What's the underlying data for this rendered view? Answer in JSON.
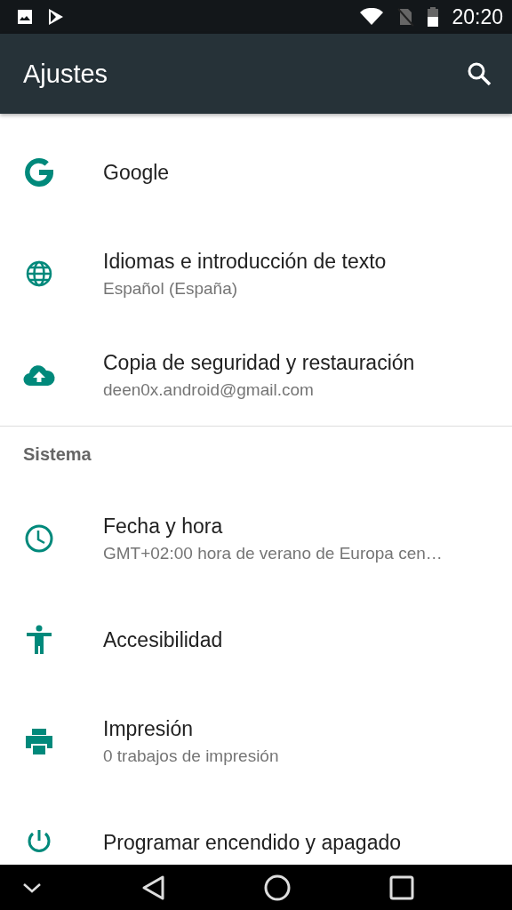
{
  "status_bar": {
    "time": "20:20"
  },
  "app_bar": {
    "title": "Ajustes"
  },
  "sections": [
    {
      "items": [
        {
          "kind": "google",
          "title": "Google"
        },
        {
          "kind": "globe",
          "title": "Idiomas e introducción de texto",
          "subtitle": "Español (España)"
        },
        {
          "kind": "cloud",
          "title": "Copia de seguridad y restauración",
          "subtitle": "deen0x.android@gmail.com"
        }
      ]
    },
    {
      "title": "Sistema",
      "items": [
        {
          "kind": "clock",
          "title": "Fecha y hora",
          "subtitle": "GMT+02:00 hora de verano de Europa cen…"
        },
        {
          "kind": "accessibility",
          "title": "Accesibilidad"
        },
        {
          "kind": "printer",
          "title": "Impresión",
          "subtitle": "0 trabajos de impresión"
        },
        {
          "kind": "power",
          "title": "Programar encendido y apagado"
        }
      ]
    }
  ]
}
